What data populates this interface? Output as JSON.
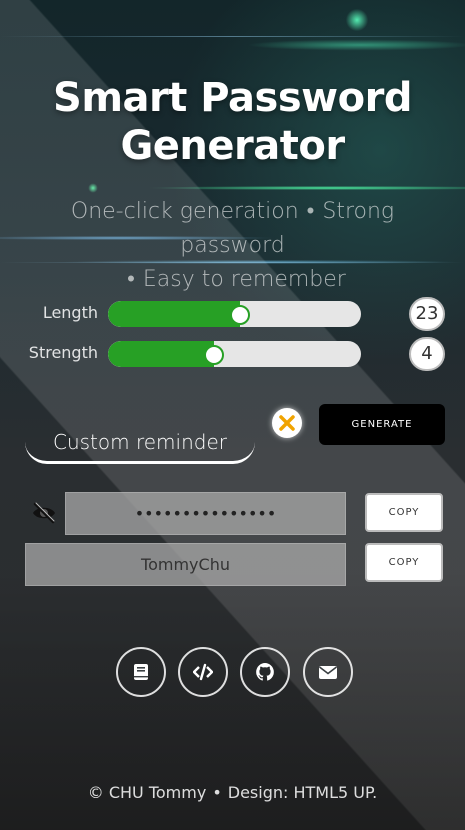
{
  "header": {
    "title_line1": "Smart Password",
    "title_line2": "Generator",
    "subtitle_part1": "One-click generation",
    "subtitle_part2": "Strong password",
    "subtitle_part3": "Easy to remember",
    "separator": "•"
  },
  "controls": {
    "length": {
      "label": "Length",
      "value": "23",
      "fraction": 0.52
    },
    "strength": {
      "label": "Strength",
      "value": "4",
      "fraction": 0.42
    },
    "slider_color": "#27a025"
  },
  "reminder": {
    "label": "Custom reminder"
  },
  "actions": {
    "generate_label": "GENERATE",
    "clear_icon": "close-icon",
    "clear_color": "#f0a300"
  },
  "output": {
    "password_value": "•••••••••••••••",
    "username_value": "TommyChu",
    "copy_label": "COPY",
    "visibility_icon": "eye-off-icon"
  },
  "links": [
    {
      "icon": "book-icon"
    },
    {
      "icon": "code-icon"
    },
    {
      "icon": "github-icon"
    },
    {
      "icon": "mail-icon"
    }
  ],
  "footer": {
    "copyright": "© CHU Tommy",
    "separator": "•",
    "design": "Design: HTML5 UP."
  }
}
